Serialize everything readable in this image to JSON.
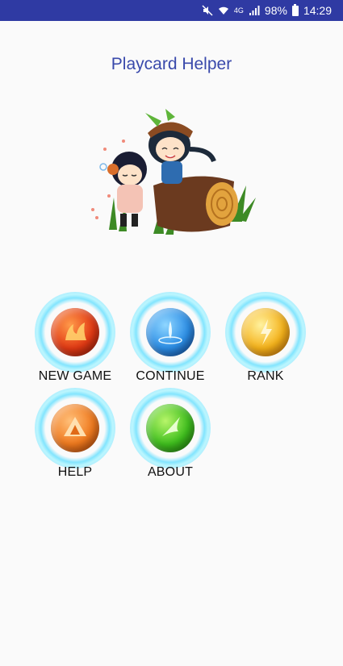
{
  "status_bar": {
    "battery": "98%",
    "time": "14:29",
    "network": "4G",
    "icons": [
      "mute-icon",
      "wifi-icon",
      "signal-icon",
      "battery-icon"
    ]
  },
  "app": {
    "title": "Playcard Helper"
  },
  "menu": {
    "new_game": {
      "label": "NEW  GAME",
      "icon": "fire-orb-icon",
      "color": "#e53a1c"
    },
    "continue": {
      "label": "CONTINUE",
      "icon": "water-orb-icon",
      "color": "#2c8ee6"
    },
    "rank": {
      "label": "RANK",
      "icon": "lightning-orb-icon",
      "color": "#f5b21a"
    },
    "help": {
      "label": "HELP",
      "icon": "earth-orb-icon",
      "color": "#f07a1e"
    },
    "about": {
      "label": "ABOUT",
      "icon": "wind-orb-icon",
      "color": "#3fbf1e"
    }
  },
  "colors": {
    "status_bar": "#2f3aa3",
    "title": "#3949ab",
    "background": "#fafafa",
    "orb_glow": "#6ee1ff"
  }
}
